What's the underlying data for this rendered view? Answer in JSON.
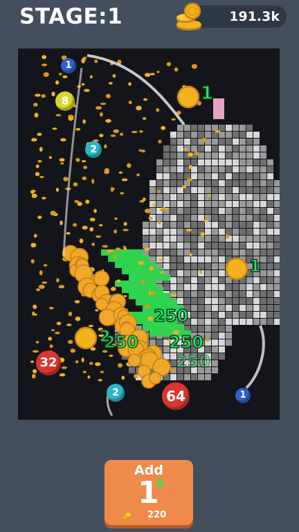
{
  "header": {
    "stage_label": "STAGE:1",
    "coins": "191.3k",
    "coin_icon": "coin-stack-icon"
  },
  "board": {
    "balls": [
      {
        "value": "1",
        "color": "#2f5fd0"
      },
      {
        "value": "8",
        "color": "#d8d62a"
      },
      {
        "value": "2",
        "color": "#2ab7c9"
      },
      {
        "value": "32",
        "color": "#d8362f"
      },
      {
        "value": "2",
        "color": "#2ab7c9"
      },
      {
        "value": "64",
        "color": "#d8362f"
      },
      {
        "value": "1",
        "color": "#2f5fd0"
      }
    ],
    "floating_numbers": [
      "1",
      "1",
      "250",
      "250",
      "250",
      "250",
      "2"
    ]
  },
  "add_button": {
    "label": "Add",
    "amount": "1",
    "plus": "+",
    "cost": "220",
    "cost_icon": "coin-icon"
  },
  "colors": {
    "background": "#444f5e",
    "board": "#14151a",
    "button": "#f08a4b",
    "accent_green": "#29e36a",
    "coin_gold": "#f2b31e"
  }
}
